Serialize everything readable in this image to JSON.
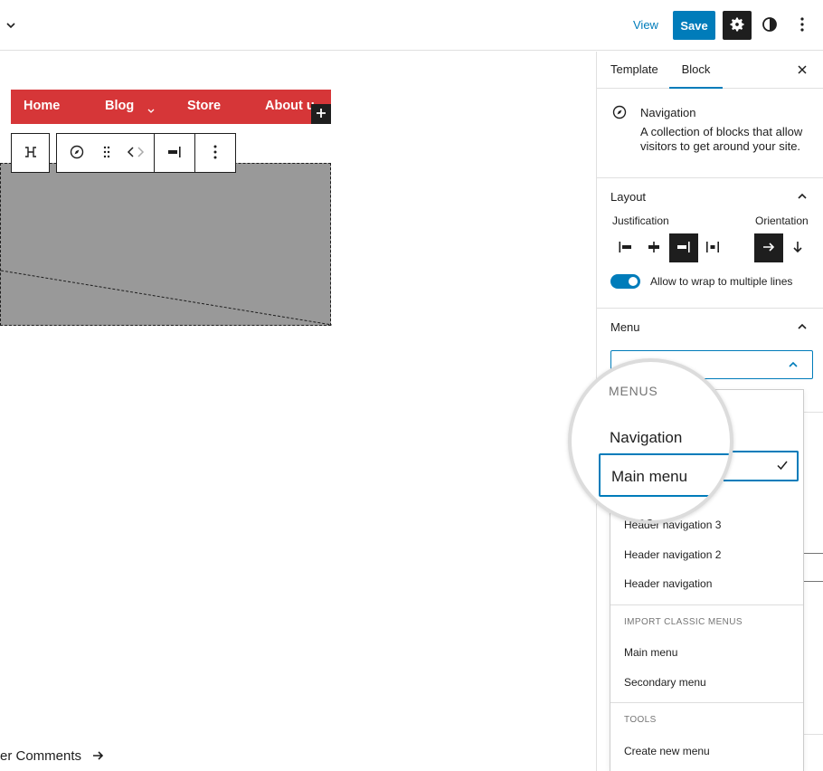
{
  "toolbar": {
    "view_label": "View",
    "save_label": "Save",
    "icons": [
      "chevron-down-icon",
      "gear-icon",
      "half-circle-icon",
      "more-vertical-icon"
    ]
  },
  "canvas": {
    "nav_items": [
      {
        "label": "Home"
      },
      {
        "label": "Blog",
        "has_submenu": true
      },
      {
        "label": "Store"
      },
      {
        "label": "About u"
      }
    ],
    "comments_link": "er Comments",
    "placeholder_color": "#999999",
    "nav_color": "#d63638"
  },
  "sidebar": {
    "tabs": [
      {
        "label": "Template",
        "active": false
      },
      {
        "label": "Block",
        "active": true
      }
    ],
    "block_card": {
      "title": "Navigation",
      "description": "A collection of blocks that allow visitors to get around your site."
    },
    "layout": {
      "title": "Layout",
      "justification_label": "Justification",
      "orientation_label": "Orientation",
      "wrap_label": "Allow to wrap to multiple lines",
      "wrap_enabled": true,
      "justification_selected": "right",
      "orientation_selected": "horizontal"
    },
    "menu": {
      "title": "Menu"
    }
  },
  "dropdown": {
    "items_top": [
      "Header navigation 3",
      "Header navigation 2",
      "Header navigation"
    ],
    "classic_group": "IMPORT CLASSIC MENUS",
    "classic_items": [
      "Main menu",
      "Secondary menu"
    ],
    "tools_group": "TOOLS",
    "tools_items": [
      "Create new menu"
    ]
  },
  "magnifier": {
    "group_label": "MENUS",
    "nav_label": "Navigation",
    "selected_label": "Main menu",
    "cut_label": "ain me"
  },
  "colors": {
    "accent": "#007cba",
    "dark": "#1e1e1e",
    "border": "#e0e0e0"
  }
}
